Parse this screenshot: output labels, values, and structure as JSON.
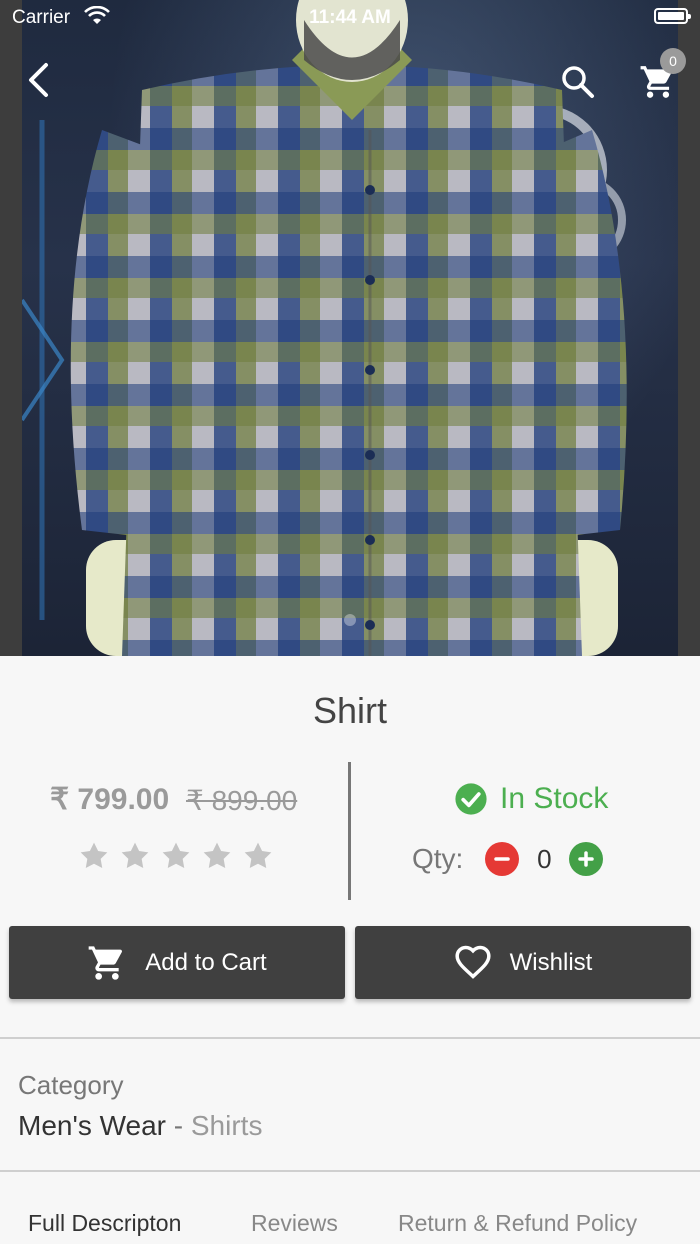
{
  "status_bar": {
    "carrier": "Carrier",
    "time": "11:44 AM"
  },
  "header": {
    "cart_count": "0"
  },
  "product": {
    "title": "Shirt",
    "price": "₹ 799.00",
    "old_price": "₹ 899.00",
    "rating": 0,
    "rating_max": 5,
    "stock_status": "In Stock",
    "qty_label": "Qty:",
    "qty_value": "0"
  },
  "actions": {
    "add_to_cart": "Add to Cart",
    "wishlist": "Wishlist"
  },
  "category": {
    "label": "Category",
    "main": "Men's Wear",
    "separator": " - ",
    "sub": "Shirts"
  },
  "tabs": [
    {
      "label": "Full Descripton",
      "active": true
    },
    {
      "label": "Reviews",
      "active": false
    },
    {
      "label": "Return & Refund Policy",
      "active": false
    }
  ],
  "colors": {
    "accent_dark": "#404040",
    "in_stock": "#4caf50",
    "minus": "#e53935",
    "plus": "#43a047",
    "muted": "#9a9a9a"
  },
  "icons": [
    "back-icon",
    "search-icon",
    "cart-icon",
    "check-circle-icon",
    "star-icon",
    "minus-icon",
    "plus-icon",
    "heart-icon"
  ]
}
